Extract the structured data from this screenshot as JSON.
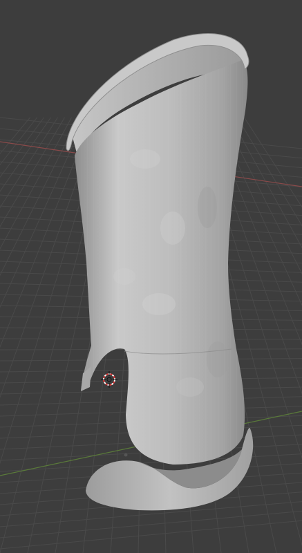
{
  "viewport": {
    "background": "#3d3d3d",
    "grid_color": "#4a4a4a",
    "x_axis_color": "#8a4a4a",
    "y_axis_color": "#5a7a3a"
  },
  "model": {
    "surface_color": "#b4b4b4",
    "highlight_color": "#d2d2d2",
    "shadow_color": "#7c7c7c",
    "rim_color": "#c8c8c8"
  },
  "cursor": {
    "icon": "3d-cursor-icon",
    "ring_color": "#111111"
  }
}
